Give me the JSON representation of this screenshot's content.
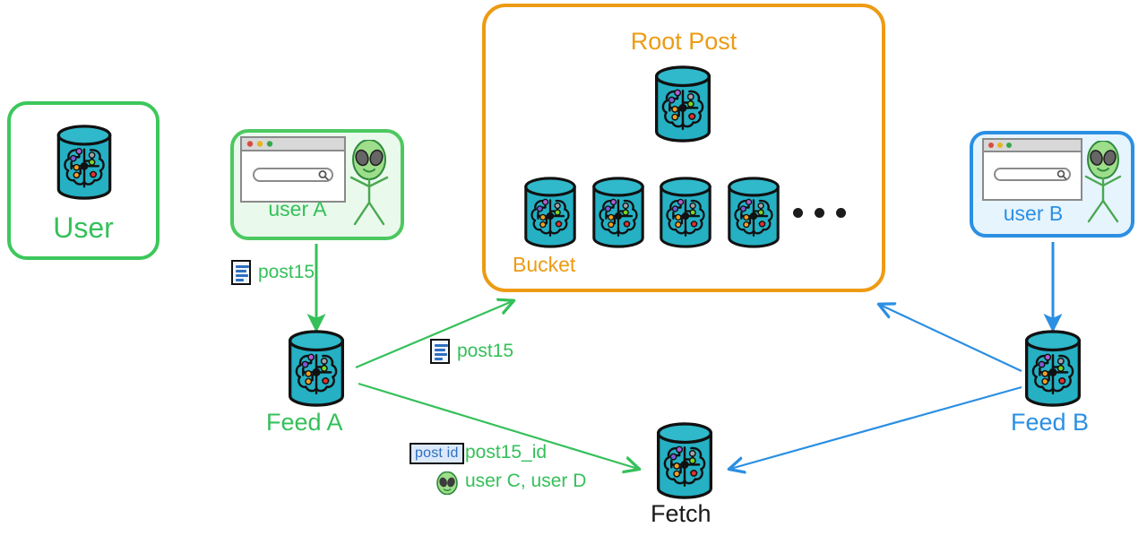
{
  "diagram": {
    "title_implicit": "Post distribution: users, feeds, buckets and fetch",
    "colors": {
      "green": "#35c05a",
      "blue": "#2b8fe3",
      "orange": "#ed9b14",
      "teal_cylinder": "#25b0c4",
      "dark_text": "#1a1a1a",
      "alien_green": "#9ede8b",
      "badge_bg": "#dce9fb",
      "usera_fill": "#e9f9ec",
      "userb_fill": "#e6f4fd"
    }
  },
  "groups": {
    "user": {
      "label": "User",
      "accent": "#35c05a"
    },
    "user_a": {
      "label": "user A",
      "accent": "#35c05a"
    },
    "user_b": {
      "label": "user B",
      "accent": "#2b8fe3"
    },
    "root_post": {
      "label": "Root Post",
      "bucket_label": "Bucket",
      "accent": "#ed9b14",
      "bucket_count": 4,
      "ellipsis": "•••"
    }
  },
  "nodes": {
    "feed_a": {
      "label": "Feed A",
      "accent": "#35c05a"
    },
    "feed_b": {
      "label": "Feed B",
      "accent": "#2b8fe3"
    },
    "fetch": {
      "label": "Fetch",
      "accent": "#1a1a1a"
    }
  },
  "edge_labels": {
    "user_a_to_feed_a": {
      "icon": "document-icon",
      "text": "post15"
    },
    "feed_a_to_root_post": {
      "icon": "document-icon",
      "text": "post15"
    },
    "feed_a_to_fetch": {
      "badge": "post id",
      "text": "post15_id",
      "icon": "alien-icon",
      "text2": "user C, user D"
    }
  },
  "browser_icon": {
    "traffic_lights": [
      "#d94b3e",
      "#e8b41f",
      "#36a84b"
    ],
    "search_placeholder": ""
  }
}
